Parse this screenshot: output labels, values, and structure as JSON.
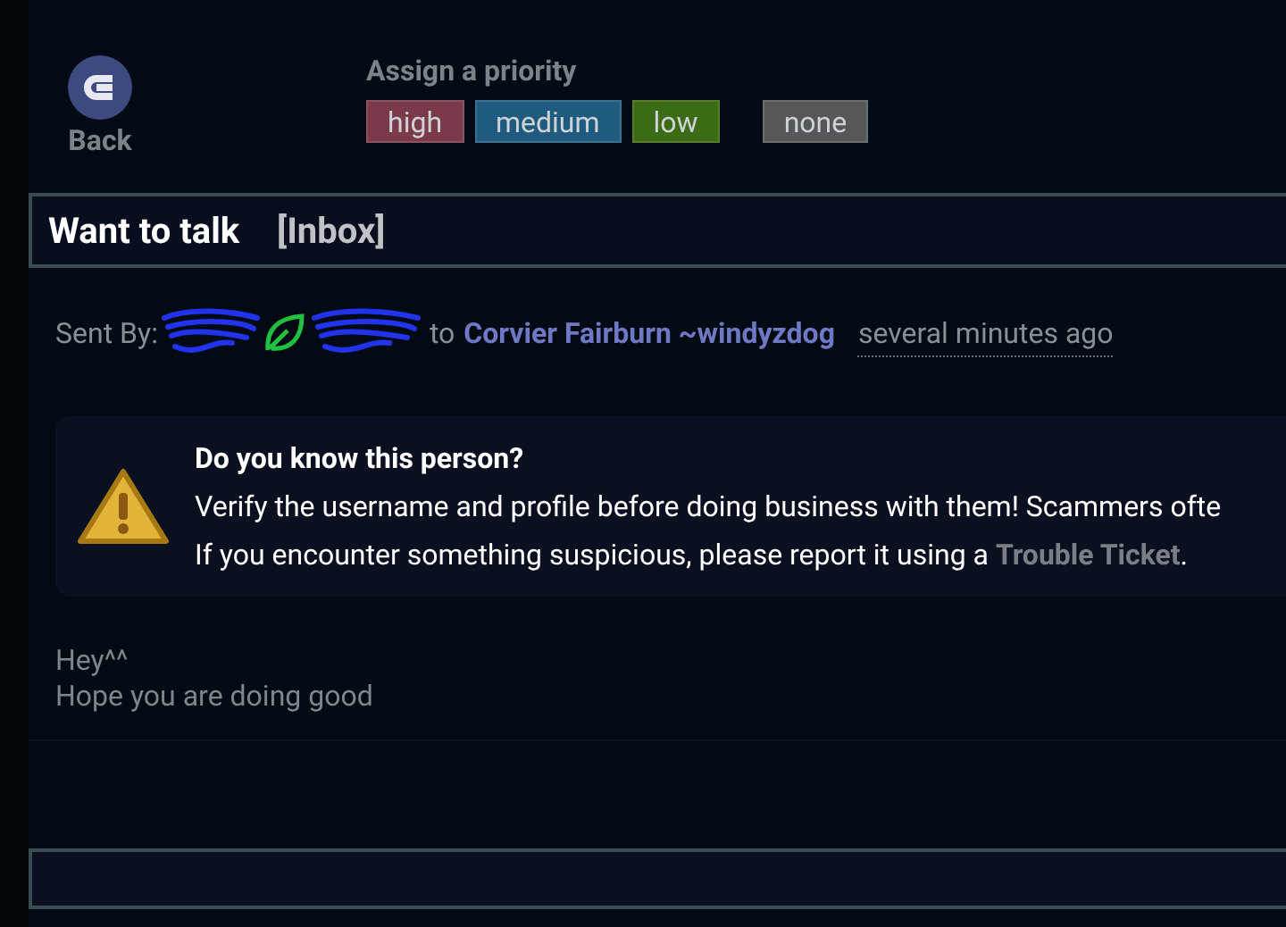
{
  "back": {
    "label": "Back"
  },
  "priority": {
    "label": "Assign a priority",
    "options": [
      {
        "label": "high",
        "color": "#7b3a4a"
      },
      {
        "label": "medium",
        "color": "#1f5a7f"
      },
      {
        "label": "low",
        "color": "#3b6b14"
      },
      {
        "label": "none",
        "color": "#555759"
      }
    ]
  },
  "message": {
    "title": "Want to talk",
    "folder": "[Inbox]",
    "sent_by": "Sent By:",
    "to": "to",
    "recipient": "Corvier Fairburn ~windyzdog",
    "time": "several minutes ago"
  },
  "notice": {
    "heading": "Do you know this person?",
    "line_1": "Verify the username and profile before doing business with them! Scammers ofte",
    "line_2_start": "If you encounter something suspicious, please report it using a",
    "link": "Trouble Ticket",
    "line_2_end": "."
  },
  "body": [
    "Hey^^",
    "Hope you are doing good"
  ]
}
